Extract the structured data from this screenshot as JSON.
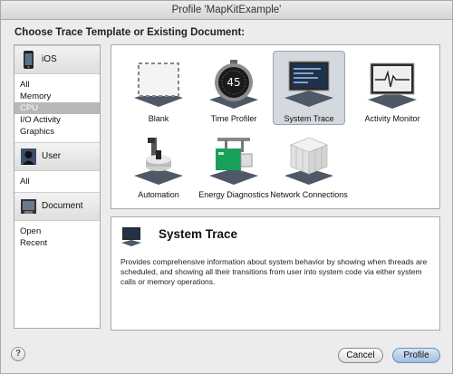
{
  "window": {
    "title": "Profile 'MapKitExample'"
  },
  "heading": "Choose Trace Template or Existing Document:",
  "sidebar": {
    "sections": [
      {
        "header": "iOS",
        "icon": "ios-device-icon",
        "items": [
          "All",
          "Memory",
          "CPU",
          "I/O Activity",
          "Graphics"
        ]
      },
      {
        "header": "User",
        "icon": "user-silhouette-icon",
        "items": [
          "All"
        ]
      },
      {
        "header": "Document",
        "icon": "document-icon",
        "items": [
          "Open",
          "Recent"
        ]
      }
    ],
    "selected": "CPU"
  },
  "templates": [
    {
      "label": "Blank",
      "icon": "blank-template-icon",
      "selected": false
    },
    {
      "label": "Time Profiler",
      "icon": "stopwatch-icon",
      "selected": false
    },
    {
      "label": "System Trace",
      "icon": "system-trace-monitor-icon",
      "selected": true
    },
    {
      "label": "Activity Monitor",
      "icon": "activity-monitor-icon",
      "selected": false
    },
    {
      "label": "Automation",
      "icon": "automation-robot-icon",
      "selected": false
    },
    {
      "label": "Energy Diagnostics",
      "icon": "energy-battery-icon",
      "selected": false
    },
    {
      "label": "Network Connections",
      "icon": "network-cube-icon",
      "selected": false
    }
  ],
  "stopwatch_reading": "45",
  "detail": {
    "title": "System Trace",
    "description": "Provides comprehensive information about system behavior by showing when threads are scheduled, and showing all their transitions from user into system code via either system calls or memory operations."
  },
  "buttons": {
    "help": "?",
    "cancel": "Cancel",
    "profile": "Profile"
  },
  "colors": {
    "selection": "#d4d8df",
    "default_button": "#9fbde0"
  }
}
